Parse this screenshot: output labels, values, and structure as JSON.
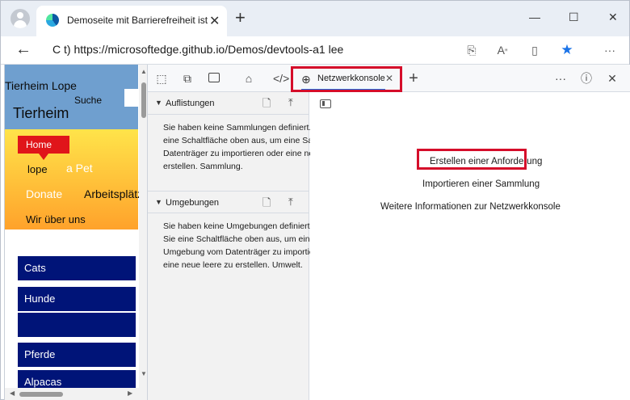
{
  "browser": {
    "tab_title": "Demoseite mit Barrierefreiheit ist",
    "tab_close": "✕",
    "new_tab": "+",
    "url": "C t) https://microsoftedge.github.io/Demos/devtools-a1 lee"
  },
  "webpage": {
    "header_title_1": "Tierheim Lope",
    "search_label": "Suche",
    "header_title_2": "Tierheim",
    "nav": {
      "home": "Home",
      "lope": "lope",
      "pet": "a Pet",
      "donate": "Donate",
      "jobs": "Arbeitsplätze",
      "about": "Wir über uns"
    },
    "list_items": [
      "Cats",
      "Hunde",
      "",
      "Pferde",
      "Alpacas"
    ]
  },
  "devtools": {
    "active_tab": "Netzwerkkonsole",
    "tab_close": "✕",
    "add_tab": "+",
    "sidebar": {
      "collections": {
        "title": "Auflistungen",
        "body": "Sie haben keine Sammlungen definiert. Wählen Sie eine Schaltfläche oben aus, um eine Sammlung vom Datenträger zu importieren oder eine neue leere zu erstellen. Sammlung."
      },
      "environments": {
        "title": "Umgebungen",
        "body": "Sie haben keine Umgebungen definiert. Wählen Sie eine Schaltfläche oben aus, um eine Umgebung vom Datenträger zu importieren oder eine neue leere zu erstellen. Umwelt."
      }
    },
    "panel": {
      "create_request": "Erstellen einer Anforderung",
      "import_collection": "Importieren einer Sammlung",
      "more_info": "Weitere Informationen zur Netzwerkkonsole"
    }
  },
  "colors": {
    "highlight": "#d50d2a",
    "accent": "#1a73e8",
    "page_header": "#6f9fcf",
    "nav_gradient_top": "#ffe44a",
    "nav_gradient_bottom": "#ffa22b",
    "home_button": "#e0151a",
    "list_item": "#001478"
  }
}
